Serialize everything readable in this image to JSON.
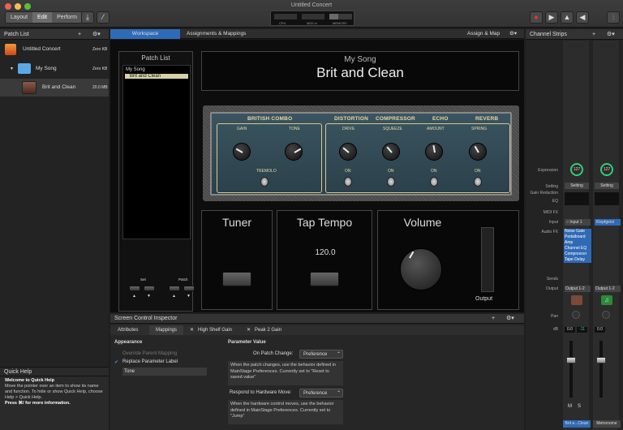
{
  "window": {
    "title": "Untitled Concert"
  },
  "toolbar": {
    "layout": "Layout",
    "edit": "Edit",
    "perform": "Perform",
    "meters": [
      "CPU",
      "MIDI In",
      "MEMORY"
    ]
  },
  "patch_list": {
    "header": "Patch List",
    "items": [
      {
        "name": "Untitled Concert",
        "size": "Zero KB"
      },
      {
        "name": "My Song",
        "size": "Zero KB"
      },
      {
        "name": "Brit and Clean",
        "size": "20.0 MB"
      }
    ]
  },
  "quick_help": {
    "title": "Quick Help",
    "heading": "Welcome to Quick Help",
    "body": "Move the pointer over an item to show its name and function. To hide or show Quick Help, choose Help > Quick Help.",
    "tip": "Press ⌘/ for more information."
  },
  "tabs": {
    "workspace": "Workspace",
    "assignments": "Assignments & Mappings",
    "assign_map": "Assign & Map"
  },
  "workspace": {
    "patchlist_title": "Patch List",
    "song": "My Song",
    "patch": "Brit and Clean",
    "set_label": "Set",
    "patch_label": "Patch",
    "header_song": "My Song",
    "header_patch": "Brit and Clean",
    "amp": {
      "sections": [
        "BRITISH COMBO",
        "DISTORTION",
        "COMPRESSOR",
        "ECHO",
        "REVERB"
      ],
      "knobs": [
        "GAIN",
        "TONE",
        "DRIVE",
        "SQUEEZE",
        "AMOUNT",
        "SPRING"
      ],
      "switches": [
        "TREMOLO",
        "ON",
        "ON",
        "ON",
        "ON"
      ]
    },
    "tuner": "Tuner",
    "tap_tempo": "Tap Tempo",
    "tempo_value": "120.0",
    "volume": "Volume",
    "output": "Output"
  },
  "inspector": {
    "title": "Screen Control Inspector",
    "tabs": [
      "Attributes",
      "Mappings",
      "High Shelf Gain",
      "Peak 2 Gain"
    ],
    "appearance": "Appearance",
    "override": "Override Parent Mapping",
    "replace": "Replace Parameter Label",
    "label_value": "Tone",
    "param_value": "Parameter Value",
    "on_patch": "On Patch Change:",
    "on_patch_val": "Preference",
    "on_patch_desc": "When the patch changes, use the behavior defined in MainStage Preferences. Currently set to \"Reset to saved value\"",
    "respond": "Respond to Hardware Move:",
    "respond_val": "Preference",
    "respond_desc": "When the hardware control moves, use the behavior defined in MainStage Preferences. Currently set to \"Jump\""
  },
  "channel_strips": {
    "header": "Channel Strips",
    "labels": [
      "Expression",
      "Setting",
      "Gain Reduction",
      "EQ",
      "MIDI FX",
      "Input",
      "Audio FX",
      "Sends",
      "Output",
      "Pan",
      "dB"
    ],
    "strip1": {
      "expr": "127",
      "setting": "Setting",
      "input": "Input 1",
      "fx": [
        "Noise Gate",
        "Pedalboard",
        "Amp",
        "Channel EQ",
        "Compressor",
        "Tape Delay"
      ],
      "output": "Output 1-2",
      "db": [
        "0.0",
        "-11"
      ],
      "name": "Brit a...Clean"
    },
    "strip2": {
      "expr": "127",
      "setting": "Setting",
      "input": "Klopfgeist",
      "output": "Output 1-2",
      "db": [
        "0.0"
      ],
      "name": "Metronome"
    },
    "ms": [
      "M",
      "S"
    ]
  }
}
